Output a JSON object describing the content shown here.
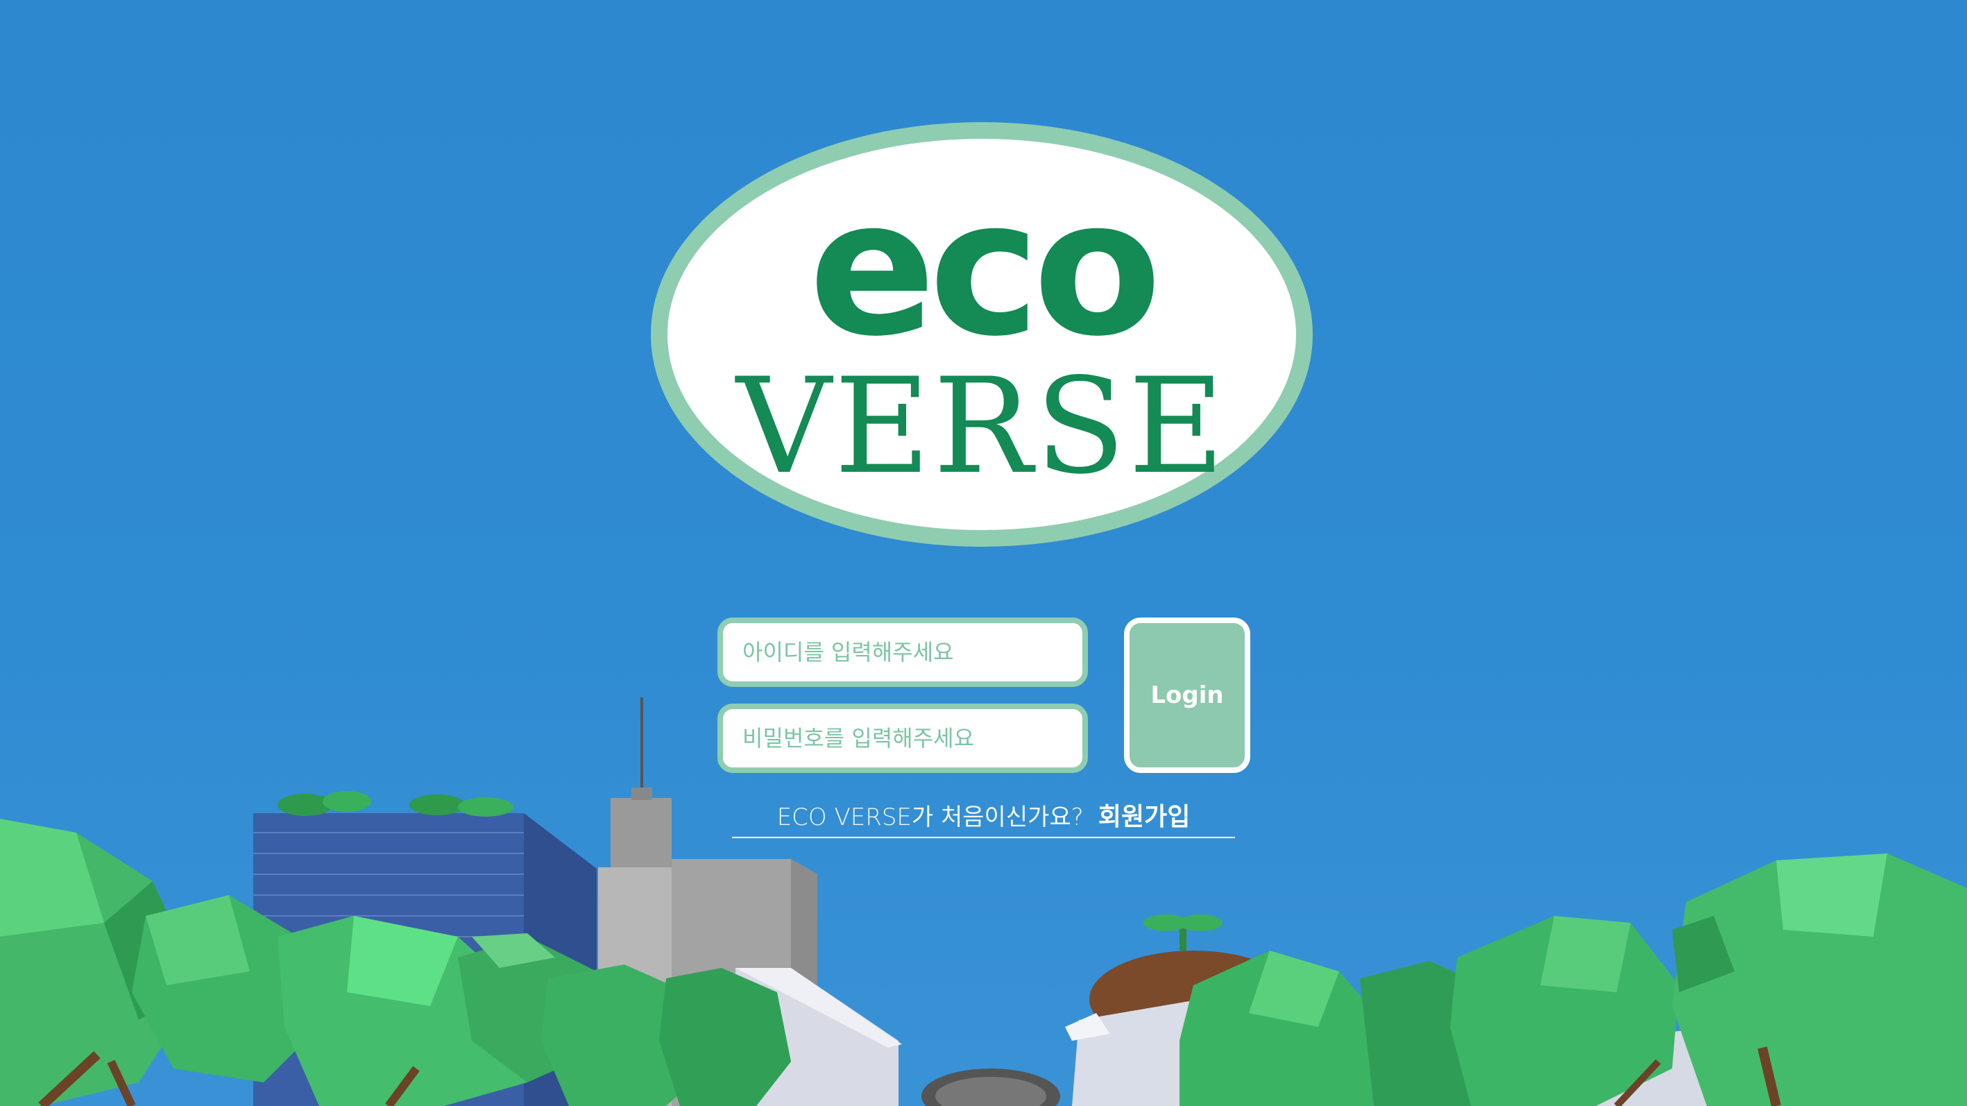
{
  "logo": {
    "line1": "eco",
    "line2": "VERSE"
  },
  "login_form": {
    "id_placeholder": "아이디를 입력해주세요",
    "password_placeholder": "비밀번호를 입력해주세요",
    "login_label": "Login"
  },
  "signup": {
    "prompt": "ECO VERSE가 처음이신가요?",
    "link_label": "회원가입"
  },
  "colors": {
    "sky": "#2e88cf",
    "accent_mint": "#8fcdb0",
    "logo_green": "#148a55",
    "tree_green": "#3fbf6e"
  }
}
